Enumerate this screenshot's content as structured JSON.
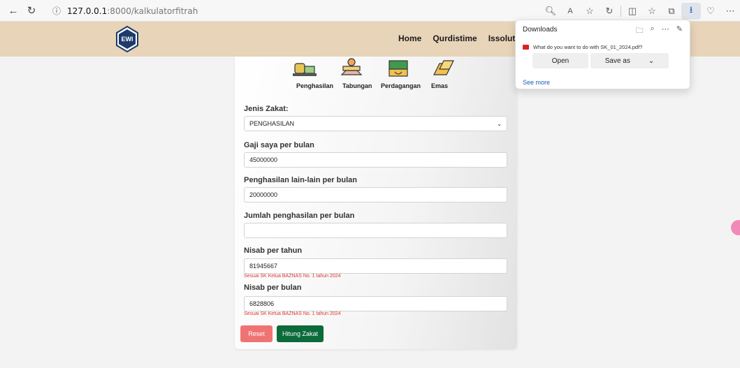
{
  "browser": {
    "url_host": "127.0.0.1",
    "url_path": ":8000/kalkulatorfitrah"
  },
  "site": {
    "logo_text": "EWI",
    "nav": [
      "Home",
      "Qurdistime",
      "Issolutic"
    ]
  },
  "categories": [
    {
      "label": "Penghasilan",
      "icon": "income-icon"
    },
    {
      "label": "Tabungan",
      "icon": "savings-icon"
    },
    {
      "label": "Perdagangan",
      "icon": "trade-icon"
    },
    {
      "label": "Emas",
      "icon": "gold-icon"
    }
  ],
  "form": {
    "jenis_label": "Jenis Zakat:",
    "jenis_value": "PENGHASILAN",
    "gaji_label": "Gaji saya per bulan",
    "gaji_value": "45000000",
    "lain_label": "Penghasilan lain-lain per bulan",
    "lain_value": "20000000",
    "jumlah_label": "Jumlah penghasilan per bulan",
    "jumlah_value": "",
    "nisab_tahun_label": "Nisab per tahun",
    "nisab_tahun_value": "81945667",
    "nisab_tahun_hint": "Sesuai SK Ketua BAZNAS No. 1 tahun 2024",
    "nisab_bulan_label": "Nisab per bulan",
    "nisab_bulan_value": "6828806",
    "nisab_bulan_hint": "Sesuai SK Ketua BAZNAS No. 1 tahun 2024",
    "reset_label": "Reset",
    "hitung_label": "Hitung Zakat"
  },
  "downloads": {
    "title": "Downloads",
    "prompt": "What do you want to do with SK_01_2024.pdf?",
    "open_label": "Open",
    "save_label": "Save as",
    "see_more": "See more"
  }
}
